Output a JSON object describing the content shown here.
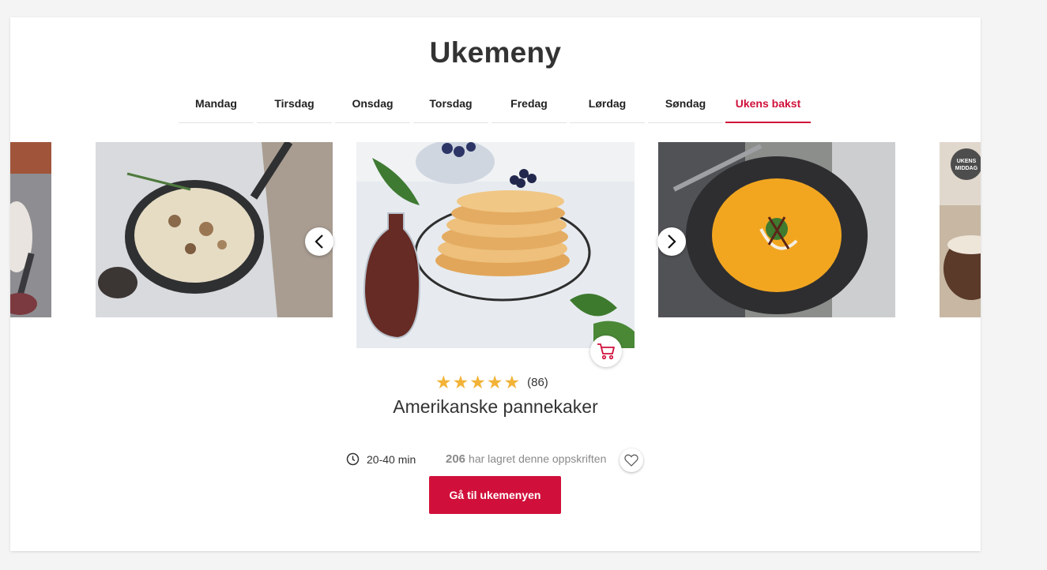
{
  "page": {
    "title": "Ukemeny"
  },
  "tabs": [
    {
      "label": "Mandag"
    },
    {
      "label": "Tirsdag"
    },
    {
      "label": "Onsdag"
    },
    {
      "label": "Torsdag"
    },
    {
      "label": "Fredag"
    },
    {
      "label": "Lørdag"
    },
    {
      "label": "Søndag"
    },
    {
      "label": "Ukens bakst",
      "active": true
    }
  ],
  "carousel": {
    "prev_icon": "chevron-left-icon",
    "next_icon": "chevron-right-icon",
    "badge_text": "UKENS MIDDAG"
  },
  "recipe": {
    "title": "Amerikanske pannekaker",
    "rating": 5,
    "rating_count": "(86)",
    "time": "20-40 min",
    "saved_count": "206",
    "saved_text": "har lagret denne oppskriften",
    "cart_icon": "cart-icon",
    "heart_icon": "heart-icon"
  },
  "cta": {
    "label": "Gå til ukemenyen"
  },
  "colors": {
    "accent": "#d0103a",
    "star": "#f2b338",
    "text": "#333333",
    "muted": "#8a8a8a"
  }
}
